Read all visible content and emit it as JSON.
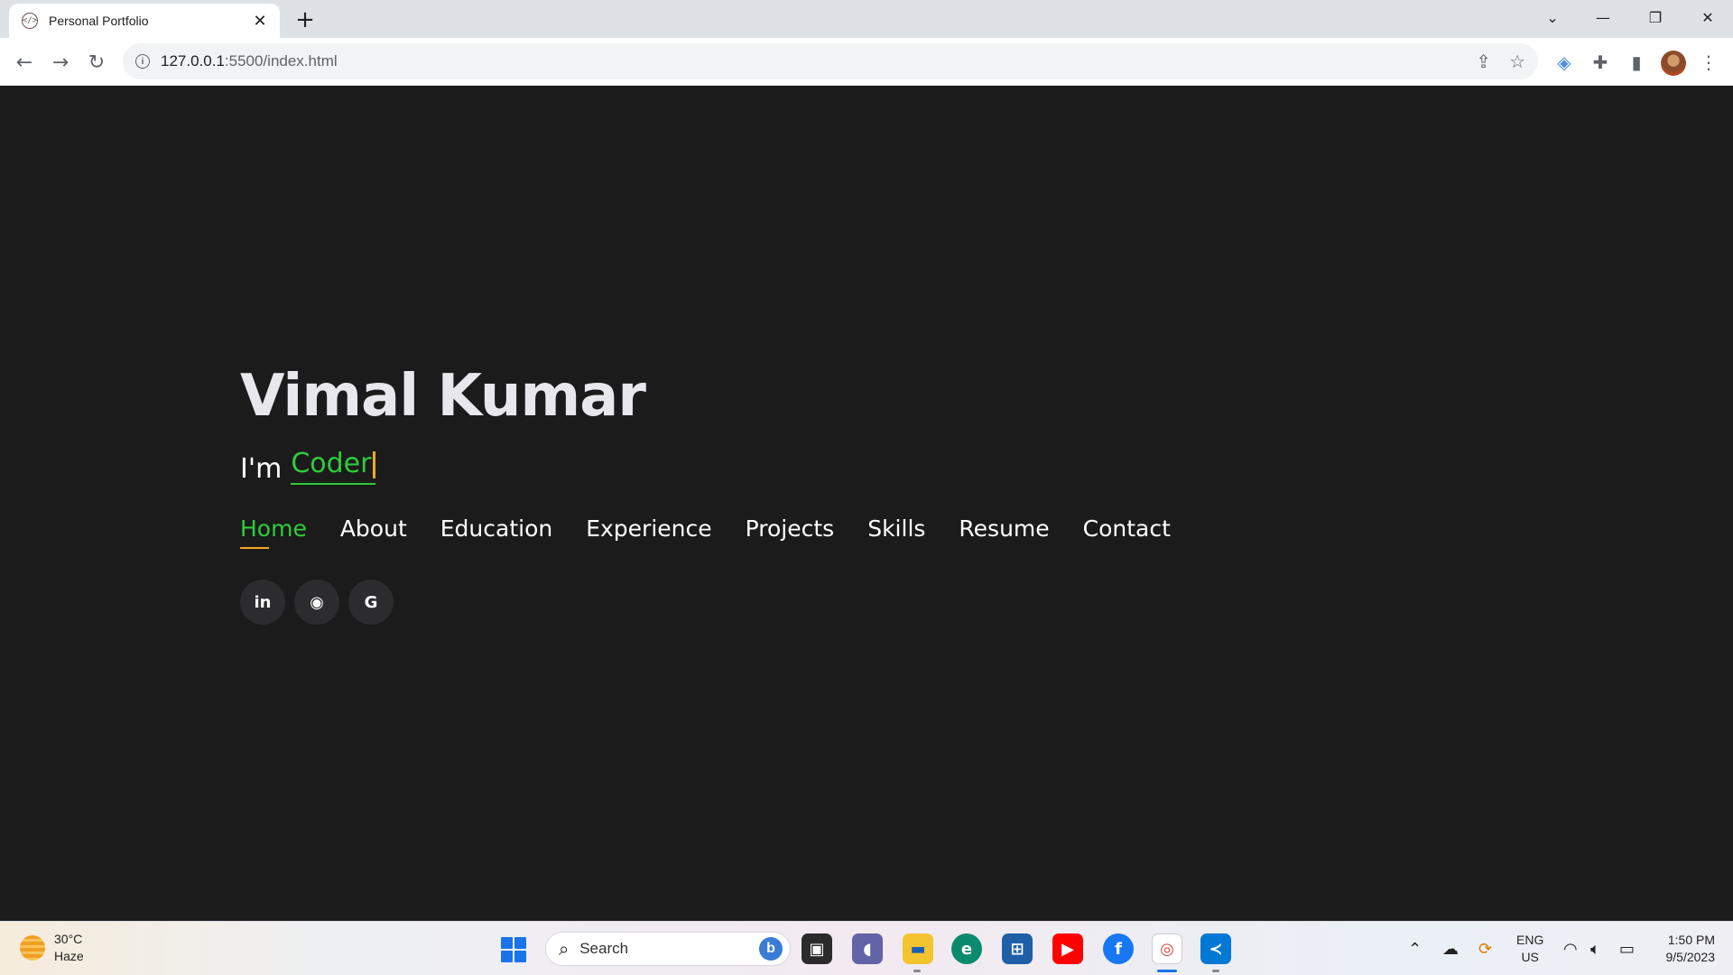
{
  "browser": {
    "tab_title": "Personal Portfolio",
    "tab_favicon": "</>",
    "url_host": "127.0.0.1",
    "url_rest": ":5500/index.html"
  },
  "hero": {
    "name": "Vimal Kumar",
    "intro": "I'm",
    "role": "Coder"
  },
  "nav": [
    "Home",
    "About",
    "Education",
    "Experience",
    "Projects",
    "Skills",
    "Resume",
    "Contact"
  ],
  "socials": [
    {
      "icon": "linkedin-icon",
      "glyph": "in"
    },
    {
      "icon": "github-icon",
      "glyph": "◉"
    },
    {
      "icon": "google-icon",
      "glyph": "G"
    }
  ],
  "taskbar": {
    "temperature": "30°C",
    "condition": "Haze",
    "search_label": "Search",
    "lang_top": "ENG",
    "lang_bottom": "US",
    "time": "1:50 PM",
    "date": "9/5/2023"
  },
  "colors": {
    "accent_green": "#2ecc3a",
    "accent_orange": "#f5a623",
    "page_bg": "#1b1b1c"
  }
}
